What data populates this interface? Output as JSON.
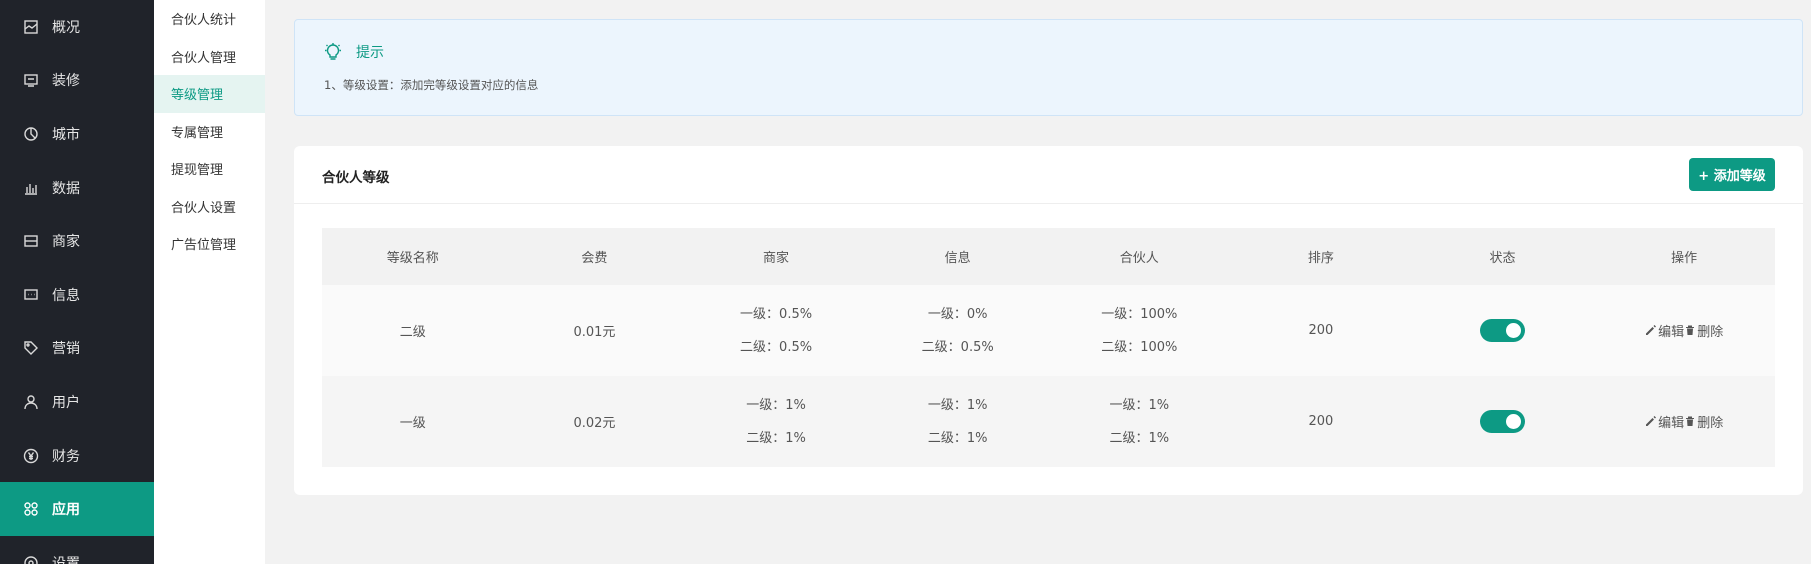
{
  "sidebar": {
    "items": [
      {
        "label": "概况",
        "icon": "overview-icon"
      },
      {
        "label": "装修",
        "icon": "decoration-icon"
      },
      {
        "label": "城市",
        "icon": "city-icon"
      },
      {
        "label": "数据",
        "icon": "chart-icon"
      },
      {
        "label": "商家",
        "icon": "store-icon"
      },
      {
        "label": "信息",
        "icon": "message-icon"
      },
      {
        "label": "营销",
        "icon": "tag-icon"
      },
      {
        "label": "用户",
        "icon": "user-icon"
      },
      {
        "label": "财务",
        "icon": "yen-icon"
      },
      {
        "label": "应用",
        "icon": "apps-icon"
      },
      {
        "label": "设置",
        "icon": "settings-icon"
      }
    ],
    "active_index": 9
  },
  "submenu": {
    "items": [
      "合伙人统计",
      "合伙人管理",
      "等级管理",
      "专属管理",
      "提现管理",
      "合伙人设置",
      "广告位管理"
    ],
    "active_index": 2
  },
  "tip": {
    "title": "提示",
    "text": "1、等级设置：添加完等级设置对应的信息"
  },
  "card": {
    "title": "合伙人等级",
    "add_button": "+ 添加等级"
  },
  "table": {
    "headers": [
      "等级名称",
      "会费",
      "商家",
      "信息",
      "合伙人",
      "排序",
      "状态",
      "操作"
    ],
    "rows": [
      {
        "name": "二级",
        "fee": "0.01元",
        "merchant": [
          "一级：0.5%",
          "二级：0.5%"
        ],
        "info": [
          "一级：0%",
          "二级：0.5%"
        ],
        "partner": [
          "一级：100%",
          "二级：100%"
        ],
        "sort": "200",
        "status": true,
        "edit": "编辑",
        "delete": "删除"
      },
      {
        "name": "一级",
        "fee": "0.02元",
        "merchant": [
          "一级：1%",
          "二级：1%"
        ],
        "info": [
          "一级：1%",
          "二级：1%"
        ],
        "partner": [
          "一级：1%",
          "二级：1%"
        ],
        "sort": "200",
        "status": true,
        "edit": "编辑",
        "delete": "删除"
      }
    ]
  },
  "colors": {
    "accent": "#0d9a84",
    "sidebar_bg": "#20232a",
    "tip_bg": "#ecf5fd"
  }
}
